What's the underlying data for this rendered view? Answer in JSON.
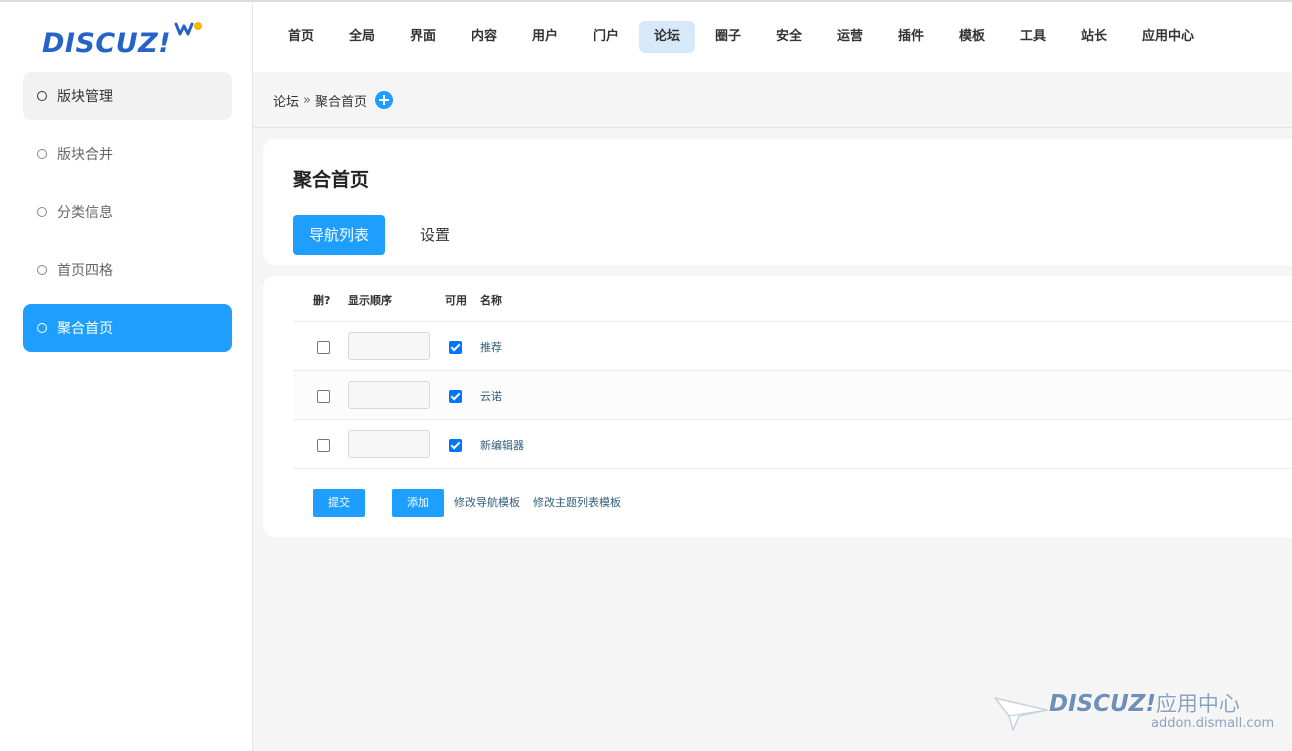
{
  "brand": {
    "logo_text": "DISCUZ!"
  },
  "sidebar": {
    "items": [
      {
        "label": "版块管理"
      },
      {
        "label": "版块合并"
      },
      {
        "label": "分类信息"
      },
      {
        "label": "首页四格"
      },
      {
        "label": "聚合首页"
      }
    ]
  },
  "topnav": {
    "items": [
      {
        "label": "首页"
      },
      {
        "label": "全局"
      },
      {
        "label": "界面"
      },
      {
        "label": "内容"
      },
      {
        "label": "用户"
      },
      {
        "label": "门户"
      },
      {
        "label": "论坛"
      },
      {
        "label": "圈子"
      },
      {
        "label": "安全"
      },
      {
        "label": "运营"
      },
      {
        "label": "插件"
      },
      {
        "label": "模板"
      },
      {
        "label": "工具"
      },
      {
        "label": "站长"
      },
      {
        "label": "应用中心"
      }
    ],
    "active": "论坛"
  },
  "breadcrumb": {
    "parent": "论坛",
    "separator": "»",
    "current": "聚合首页"
  },
  "page": {
    "title": "聚合首页",
    "tabs": [
      {
        "label": "导航列表"
      },
      {
        "label": "设置"
      }
    ]
  },
  "table": {
    "headers": {
      "delete": "删?",
      "order": "显示顺序",
      "enabled": "可用",
      "name": "名称"
    },
    "rows": [
      {
        "order": "",
        "enabled": true,
        "name": "推荐"
      },
      {
        "order": "",
        "enabled": true,
        "name": "云诺"
      },
      {
        "order": "",
        "enabled": true,
        "name": "新编辑器"
      }
    ]
  },
  "actions": {
    "submit": "提交",
    "add": "添加",
    "edit_nav_template": "修改导航模板",
    "edit_topic_list_template": "修改主题列表模板"
  },
  "watermark": {
    "title": "DISCUZ!",
    "title_cn": "应用中心",
    "subtitle": "addon.dismall.com"
  },
  "colors": {
    "accent": "#1e9fff",
    "brand": "#2563c9",
    "link": "#335f7c",
    "nav_active_bg": "#d7e8f8"
  }
}
